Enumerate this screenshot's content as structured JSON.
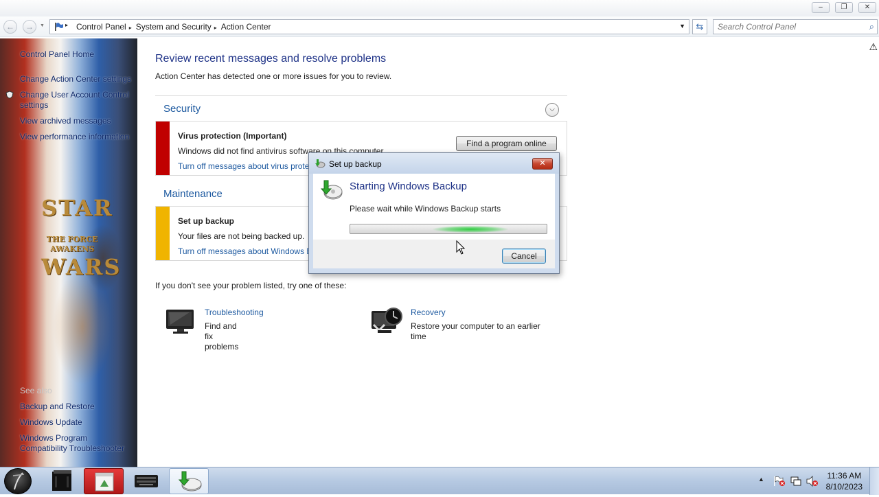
{
  "breadcrumb": [
    "Control Panel",
    "System and Security",
    "Action Center"
  ],
  "search": {
    "placeholder": "Search Control Panel"
  },
  "sidebar": {
    "links": [
      "Control Panel Home",
      "Change Action Center settings",
      "Change User Account Control settings",
      "View archived messages",
      "View performance information"
    ],
    "see_also_label": "See also",
    "see_also": [
      "Backup and Restore",
      "Windows Update",
      "Windows Program Compatibility Troubleshooter"
    ],
    "wallpaper_logo": [
      "STAR",
      "WARS"
    ],
    "wallpaper_tagline": "THE FORCE AWAKENS"
  },
  "main": {
    "title": "Review recent messages and resolve problems",
    "subtitle": "Action Center has detected one or more issues for you to review.",
    "security": {
      "heading": "Security",
      "item_title": "Virus protection  (Important)",
      "item_desc": "Windows did not find antivirus software on this computer.",
      "item_link": "Turn off messages about virus protection",
      "button": "Find a program online",
      "color": "#c00000"
    },
    "maintenance": {
      "heading": "Maintenance",
      "item_title": "Set up backup",
      "item_desc": "Your files are not being backed up.",
      "item_link": "Turn off messages about Windows Backup",
      "color": "#f0b400"
    },
    "try_text": "If you don't see your problem listed, try one of these:",
    "tools": [
      {
        "link": "Troubleshooting",
        "desc": "Find and fix problems",
        "icon": "monitor-icon"
      },
      {
        "link": "Recovery",
        "desc": "Restore your computer to an earlier time",
        "icon": "recovery-icon"
      }
    ]
  },
  "dialog": {
    "title": "Set up backup",
    "heading": "Starting Windows Backup",
    "message": "Please wait while Windows Backup starts",
    "cancel": "Cancel",
    "progress": "indeterminate"
  },
  "taskbar": {
    "time": "11:36 AM",
    "date": "8/10/2023"
  }
}
